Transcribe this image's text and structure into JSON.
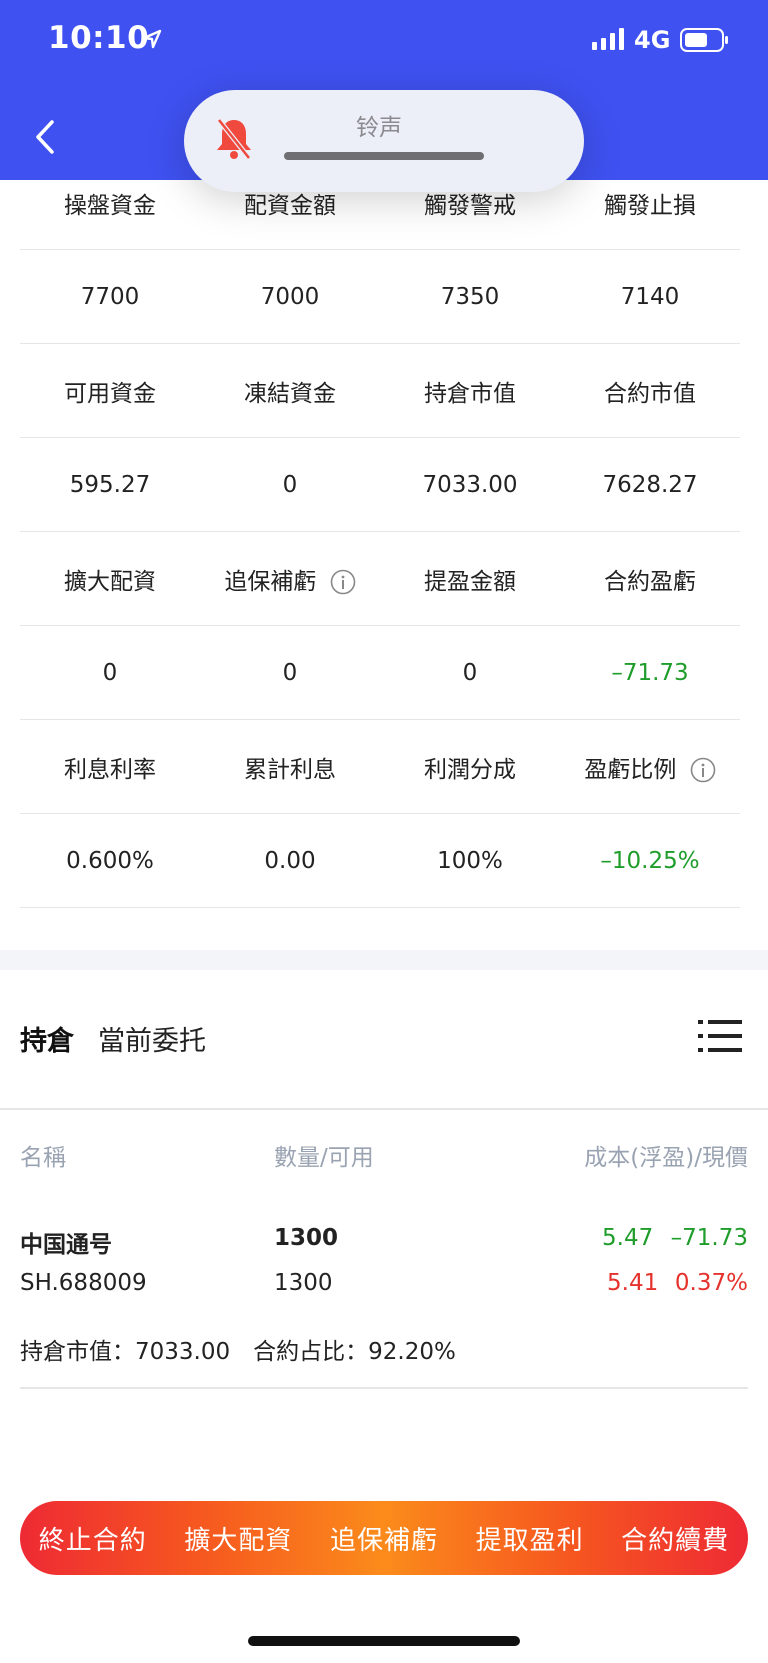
{
  "status_bar": {
    "time": "10:10",
    "network": "4G"
  },
  "ringer": {
    "label": "铃声"
  },
  "info_grid": {
    "rows": [
      {
        "cells": [
          {
            "text": "操盤資金"
          },
          {
            "text": "配資金額"
          },
          {
            "text": "觸發警戒"
          },
          {
            "text": "觸發止損"
          }
        ]
      },
      {
        "cells": [
          {
            "text": "7700"
          },
          {
            "text": "7000"
          },
          {
            "text": "7350"
          },
          {
            "text": "7140"
          }
        ]
      },
      {
        "cells": [
          {
            "text": "可用資金"
          },
          {
            "text": "凍結資金"
          },
          {
            "text": "持倉市值"
          },
          {
            "text": "合約市值"
          }
        ]
      },
      {
        "cells": [
          {
            "text": "595.27"
          },
          {
            "text": "0"
          },
          {
            "text": "7033.00"
          },
          {
            "text": "7628.27"
          }
        ]
      },
      {
        "cells": [
          {
            "text": "擴大配資"
          },
          {
            "text": "追保補虧"
          },
          {
            "text": "提盈金額"
          },
          {
            "text": "合約盈虧"
          }
        ]
      },
      {
        "cells": [
          {
            "text": "0"
          },
          {
            "text": "0"
          },
          {
            "text": "0"
          },
          {
            "text": "–71.73"
          }
        ]
      },
      {
        "cells": [
          {
            "text": "利息利率"
          },
          {
            "text": "累計利息"
          },
          {
            "text": "利潤分成"
          },
          {
            "text": "盈虧比例"
          }
        ]
      },
      {
        "cells": [
          {
            "text": "0.600%"
          },
          {
            "text": "0.00"
          },
          {
            "text": "100%"
          },
          {
            "text": "–10.25%"
          }
        ]
      }
    ]
  },
  "tabs": [
    {
      "label": "持倉"
    },
    {
      "label": "當前委托"
    }
  ],
  "holdings": {
    "headers": {
      "name": "名稱",
      "qty": "數量/可用",
      "cost": "成本(浮盈)/現價"
    },
    "items": [
      {
        "name": "中国通号",
        "code": "SH.688009",
        "qty": "1300",
        "avail": "1300",
        "cost": "5.47",
        "float_pnl": "–71.73",
        "price": "5.41",
        "change": "0.37%",
        "summary": "持倉市值：7033.00　合約占比：92.20%"
      }
    ]
  },
  "actions": [
    {
      "label": "終止合約"
    },
    {
      "label": "擴大配資"
    },
    {
      "label": "追保補虧"
    },
    {
      "label": "提取盈利"
    },
    {
      "label": "合約續費"
    }
  ],
  "colors": {
    "header": "#3f51f0",
    "positive": "#e5322d",
    "negative": "#1f9d2a"
  }
}
